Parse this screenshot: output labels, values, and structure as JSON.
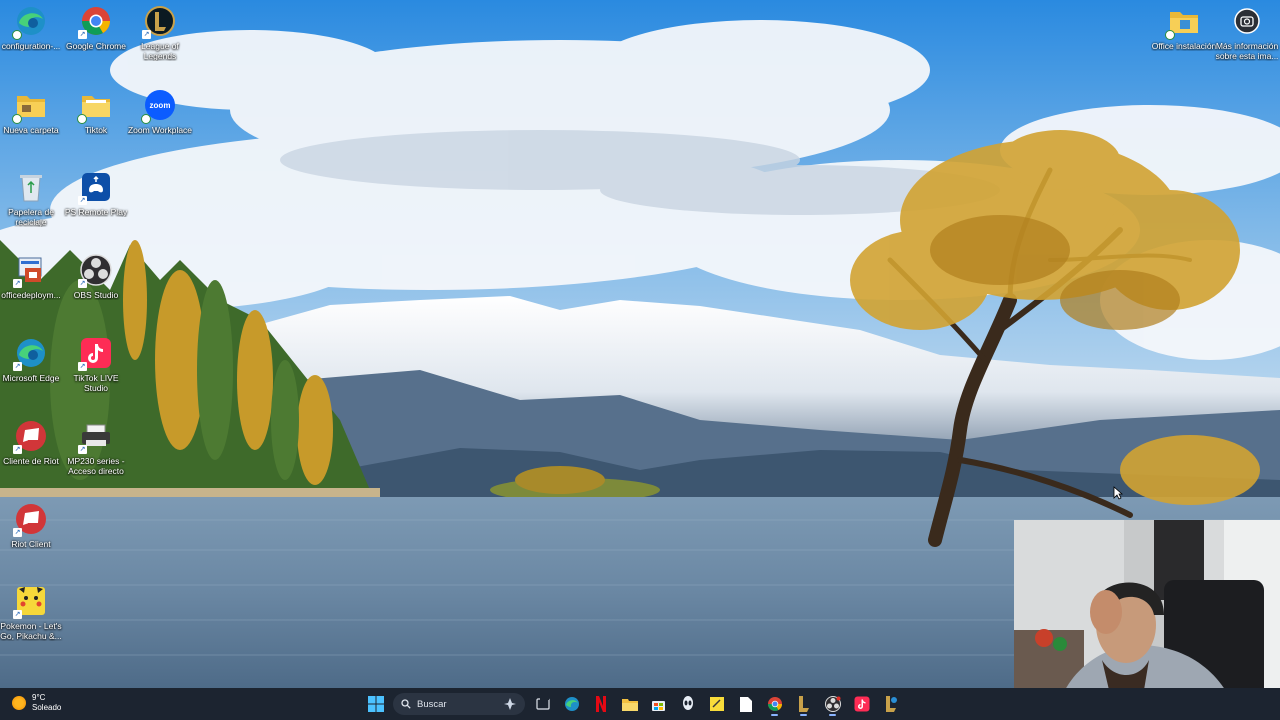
{
  "desktop": {
    "icons_left": [
      {
        "name": "configuration-icon",
        "label": "configuration-..."
      },
      {
        "name": "chrome-icon",
        "label": "Google Chrome"
      },
      {
        "name": "league-icon",
        "label": "League of Legends"
      },
      {
        "name": "folder-icon",
        "label": "Nueva carpeta"
      },
      {
        "name": "folder-icon",
        "label": "Tiktok"
      },
      {
        "name": "zoom-icon",
        "label": "Zoom Workplace"
      },
      {
        "name": "recycle-bin-icon",
        "label": "Papelera de reciclaje"
      },
      {
        "name": "ps-remote-play-icon",
        "label": "PS Remote Play"
      },
      {
        "name": "office-deployment-icon",
        "label": "officedeploym..."
      },
      {
        "name": "obs-icon",
        "label": "OBS Studio"
      },
      {
        "name": "edge-icon",
        "label": "Microsoft Edge"
      },
      {
        "name": "tiktok-live-icon",
        "label": "TikTok LIVE Studio"
      },
      {
        "name": "riot-icon",
        "label": "Cliente de Riot"
      },
      {
        "name": "printer-icon",
        "label": "MP230 series - Acceso directo"
      },
      {
        "name": "riot-icon",
        "label": "Riot Client"
      },
      {
        "name": "pokemon-icon",
        "label": "Pokemon - Let's Go, Pikachu &..."
      }
    ],
    "icons_right": [
      {
        "name": "folder-icon",
        "label": "Office instalación"
      },
      {
        "name": "camera-info-icon",
        "label": "Más información sobre esta ima..."
      }
    ]
  },
  "taskbar": {
    "weather": {
      "temp": "9°C",
      "condition": "Soleado"
    },
    "search_label": "Buscar",
    "apps": [
      "start-icon",
      "search",
      "copilot-icon",
      "task-view-icon",
      "edge-icon",
      "netflix-icon",
      "file-explorer-icon",
      "store-icon",
      "alienware-icon",
      "sticky-notes-icon",
      "file-icon",
      "chrome-icon",
      "league-icon",
      "obs-icon",
      "tiktok-icon",
      "league-client-icon"
    ]
  },
  "colors": {
    "taskbar": "#1c2430",
    "accent": "#8ab4ff",
    "sky": "#3a97e0",
    "lake": "#6c8aa6"
  }
}
